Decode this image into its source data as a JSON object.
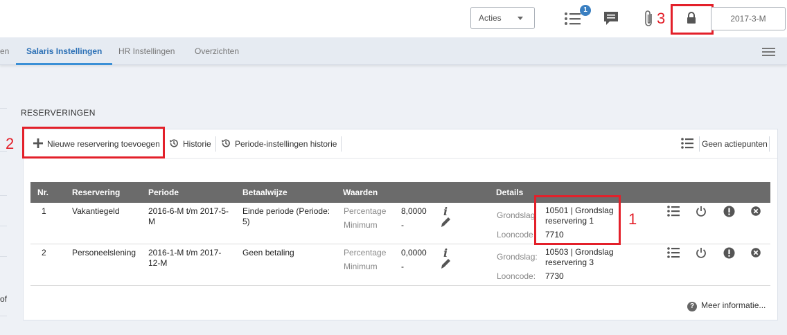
{
  "header": {
    "acties_label": "Acties",
    "badge_count": "1",
    "period_label": "2017-3-M"
  },
  "annotations": {
    "one": "1",
    "two": "2",
    "three": "3"
  },
  "tabs": [
    {
      "label": "en"
    },
    {
      "label": "Salaris Instellingen"
    },
    {
      "label": "HR Instellingen"
    },
    {
      "label": "Overzichten"
    }
  ],
  "left_fragment": "of",
  "section": {
    "title": "RESERVERINGEN"
  },
  "toolbar": {
    "add_label": "Nieuwe reservering toevoegen",
    "history_label": "Historie",
    "period_history_label": "Periode-instellingen historie",
    "actions_label": "Geen actiepunten"
  },
  "table": {
    "headers": {
      "nr": "Nr.",
      "reservering": "Reservering",
      "periode": "Periode",
      "betaalwijze": "Betaalwijze",
      "waarden": "Waarden",
      "details": "Details"
    },
    "rows": [
      {
        "nr": "1",
        "reservering": "Vakantiegeld",
        "periode": "2016-6-M t/m 2017-5-M",
        "betaalwijze": "Einde periode (Periode: 5)",
        "percentage_label": "Percentage",
        "percentage_value": "8,0000",
        "minimum_label": "Minimum",
        "minimum_value": "-",
        "grondslag_label": "Grondslag",
        "grondslag_value": "10501 | Grondslag reservering 1",
        "looncode_label": "Looncode",
        "looncode_value": "7710"
      },
      {
        "nr": "2",
        "reservering": "Personeelslening",
        "periode": "2016-1-M t/m 2017-12-M",
        "betaalwijze": "Geen betaling",
        "percentage_label": "Percentage",
        "percentage_value": "0,0000",
        "minimum_label": "Minimum",
        "minimum_value": "-",
        "grondslag_label": "Grondslag:",
        "grondslag_value": "10503 | Grondslag reservering 3",
        "looncode_label": "Looncode:",
        "looncode_value": "7730"
      }
    ]
  },
  "footer": {
    "more_info": "Meer informatie..."
  },
  "colors": {
    "accent": "#3a8fd6",
    "annotation_red": "#e3202a",
    "table_header": "#6b6b6b"
  }
}
